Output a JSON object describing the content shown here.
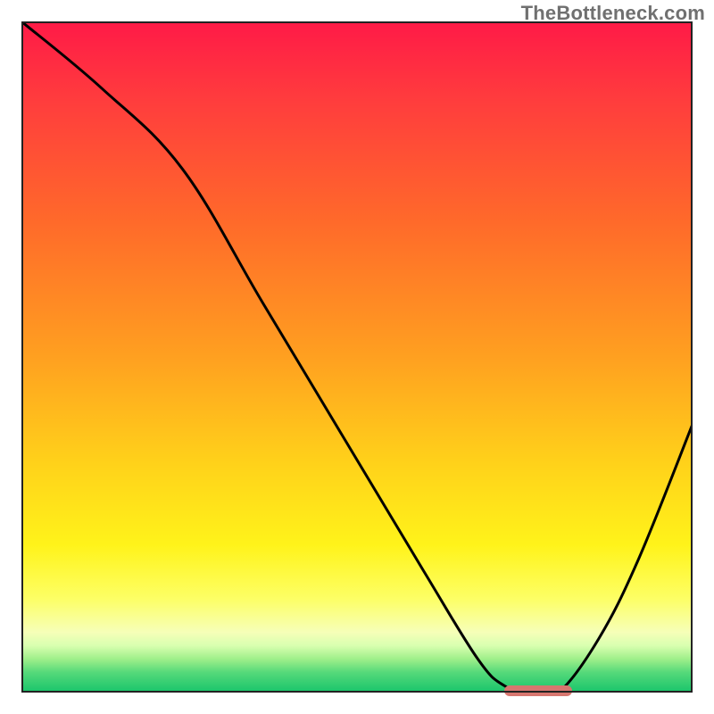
{
  "watermark": "TheBottleneck.com",
  "chart_data": {
    "type": "line",
    "title": "",
    "xlabel": "",
    "ylabel": "",
    "xlim": [
      0,
      100
    ],
    "ylim": [
      0,
      100
    ],
    "x": [
      0,
      12,
      24,
      36,
      48,
      60,
      68,
      72,
      76,
      80,
      86,
      92,
      100
    ],
    "values": [
      100,
      90,
      78,
      58,
      38,
      18,
      5,
      1,
      0,
      0,
      8,
      20,
      40
    ],
    "marker": {
      "x_start": 72,
      "x_end": 82,
      "y": 0
    },
    "gradient_stops": [
      {
        "pos": 0,
        "color": "#ff1a47"
      },
      {
        "pos": 30,
        "color": "#ff6a2a"
      },
      {
        "pos": 66,
        "color": "#ffd21a"
      },
      {
        "pos": 86,
        "color": "#fdff65"
      },
      {
        "pos": 97,
        "color": "#55d97a"
      },
      {
        "pos": 100,
        "color": "#17c46b"
      }
    ]
  }
}
